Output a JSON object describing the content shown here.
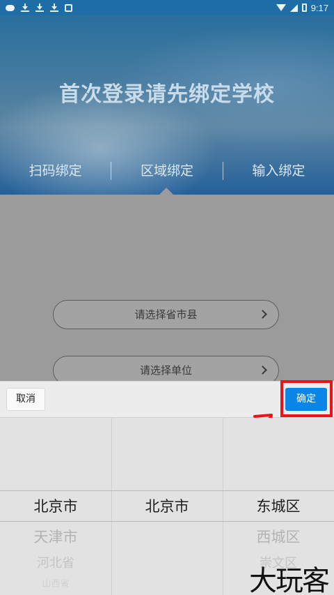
{
  "status_bar": {
    "time": "9:17"
  },
  "header": {
    "title": "首次登录请先绑定学校"
  },
  "tabs": [
    {
      "label": "扫码绑定"
    },
    {
      "label": "区域绑定"
    },
    {
      "label": "输入绑定"
    }
  ],
  "form": {
    "province_select": "请选择省市县",
    "unit_select": "请选择单位"
  },
  "picker": {
    "cancel_label": "取消",
    "confirm_label": "确定",
    "province_column": [
      "北京市",
      "天津市",
      "河北省",
      "山西省"
    ],
    "city_column": [
      "北京市"
    ],
    "district_column": [
      "东城区",
      "西城区",
      "崇文区"
    ]
  },
  "watermark": "大玩客",
  "colors": {
    "confirm_button": "#0a86e8",
    "annotation_red": "#e8141b"
  }
}
